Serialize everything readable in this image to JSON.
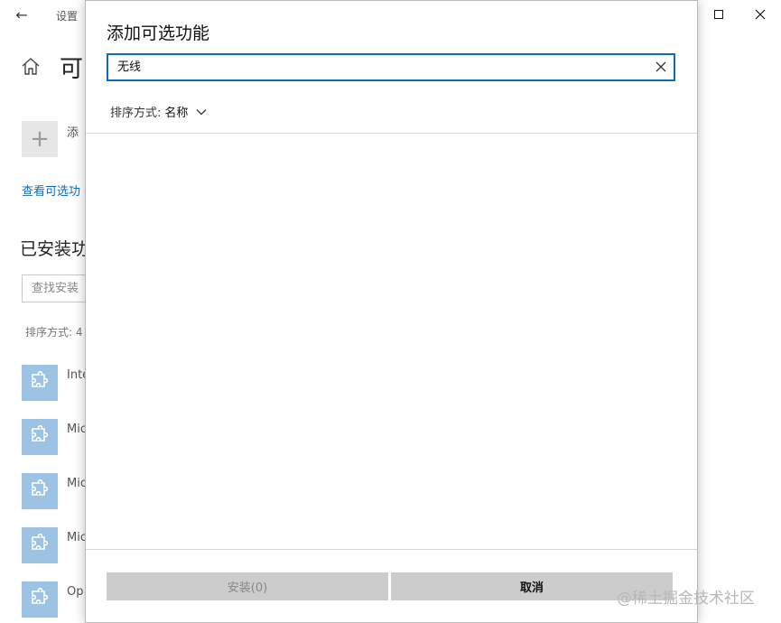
{
  "background_window": {
    "title": "设置",
    "page_title": "可",
    "add_label": "添",
    "view_link": "查看可选功",
    "installed_heading": "已安装功",
    "find_placeholder": "查找安装",
    "sort_label": "排序方式: 4",
    "features": [
      {
        "name": "Inte"
      },
      {
        "name": "Mic"
      },
      {
        "name": "Mic"
      },
      {
        "name": "Mic"
      },
      {
        "name": "Op"
      }
    ]
  },
  "dialog": {
    "title": "添加可选功能",
    "search": {
      "value": "无线"
    },
    "sort": {
      "label": "排序方式:",
      "value": "名称"
    },
    "install_button": "安装(0)",
    "cancel_button": "取消"
  },
  "watermark": "@稀土掘金技术社区",
  "colors": {
    "accent": "#0a6cc2",
    "feature_tile": "#9cc3e3",
    "button_bg": "#cccccc"
  }
}
